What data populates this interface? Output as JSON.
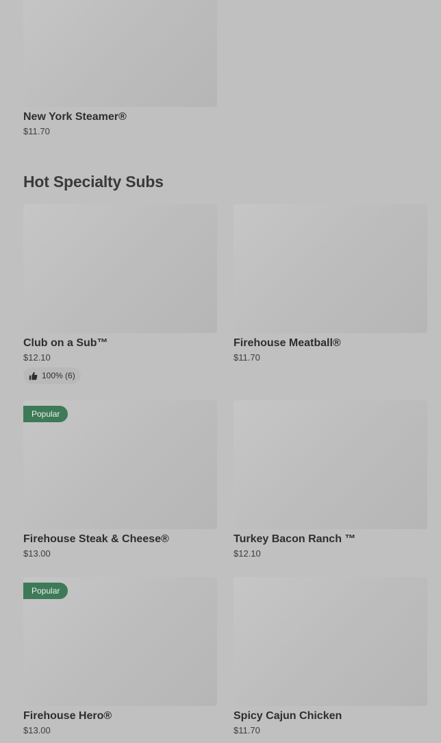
{
  "previous_section": {
    "items": [
      {
        "name": "New York Steamer®",
        "price": "$11.70"
      }
    ]
  },
  "section": {
    "title": "Hot Specialty Subs",
    "items": [
      {
        "name": "Club on a Sub™",
        "price": "$12.10",
        "rating": "100% (6)"
      },
      {
        "name": "Firehouse Meatball®",
        "price": "$11.70"
      },
      {
        "name": "Firehouse Steak & Cheese®",
        "price": "$13.00",
        "badge": "Popular"
      },
      {
        "name": "Turkey Bacon Ranch ™",
        "price": "$12.10"
      },
      {
        "name": "Firehouse Hero®",
        "price": "$13.00",
        "badge": "Popular"
      },
      {
        "name": "Spicy Cajun Chicken",
        "price": "$11.70"
      }
    ]
  },
  "colors": {
    "page_background": "#c0c0c0",
    "image_placeholder": "#bdbdbd",
    "popular_badge": "#3e7a58"
  },
  "icons": {
    "rating": "thumbs-up-icon"
  }
}
